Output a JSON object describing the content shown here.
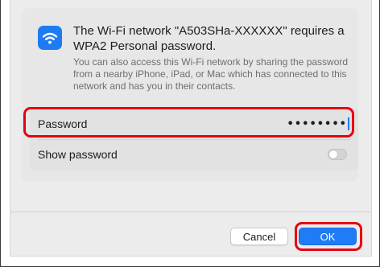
{
  "dialog": {
    "headline": "The Wi-Fi network \"A503SHa-XXXXXX\" requires a WPA2 Personal password.",
    "subtext": "You can also access this Wi-Fi network by sharing the password from a nearby iPhone, iPad, or Mac which has connected to this network and has you in their contacts.",
    "icon": "wifi-icon"
  },
  "fields": {
    "password_label": "Password",
    "password_value": "••••••••",
    "show_password_label": "Show password",
    "show_password_on": false
  },
  "buttons": {
    "cancel_label": "Cancel",
    "ok_label": "OK"
  },
  "colors": {
    "accent": "#1f7cf4",
    "highlight": "#e60012",
    "dialog_bg": "#ececec"
  }
}
